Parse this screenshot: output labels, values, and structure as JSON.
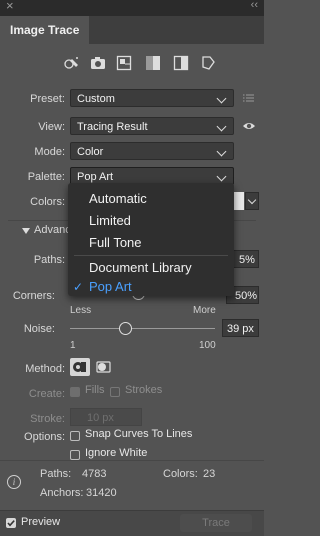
{
  "panel": {
    "tab_title": "Image Trace",
    "collapse_glyph": "‹‹",
    "close_glyph": "×"
  },
  "icons": [
    "auto-color-icon",
    "camera-icon",
    "palette-grid-icon",
    "grayscale-icon",
    "black-white-icon",
    "outline-icon"
  ],
  "fields": {
    "preset": {
      "label": "Preset:",
      "value": "Custom"
    },
    "view": {
      "label": "View:",
      "value": "Tracing Result"
    },
    "mode": {
      "label": "Mode:",
      "value": "Color"
    },
    "palette": {
      "label": "Palette:",
      "value": "Pop Art"
    },
    "colors": {
      "label": "Colors:"
    }
  },
  "dropdown": {
    "items": [
      "Automatic",
      "Limited",
      "Full Tone",
      "Document Library",
      "Pop Art"
    ],
    "selected": "Pop Art",
    "checkmark": "✓"
  },
  "advanced": {
    "label": "Advanc",
    "paths": {
      "label": "Paths:",
      "value": "5%"
    },
    "corners": {
      "label": "Corners:",
      "value": "50%",
      "min_label": "Less",
      "max_label": "More"
    },
    "noise": {
      "label": "Noise:",
      "value": "39 px",
      "min": "1",
      "max": "100",
      "level_percent": 38
    },
    "method": {
      "label": "Method:"
    },
    "create": {
      "label": "Create:",
      "fills": "Fills",
      "strokes": "Strokes"
    },
    "stroke": {
      "label": "Stroke:",
      "value": "10 px"
    },
    "options": {
      "label": "Options:",
      "snap": "Snap Curves To Lines",
      "ignore_white": "Ignore White"
    }
  },
  "info": {
    "paths_label": "Paths:",
    "paths_value": "4783",
    "colors_label": "Colors:",
    "colors_value": "23",
    "anchors_label": "Anchors:",
    "anchors_value": "31420"
  },
  "bottom": {
    "preview_label": "Preview",
    "trace_label": "Trace"
  }
}
